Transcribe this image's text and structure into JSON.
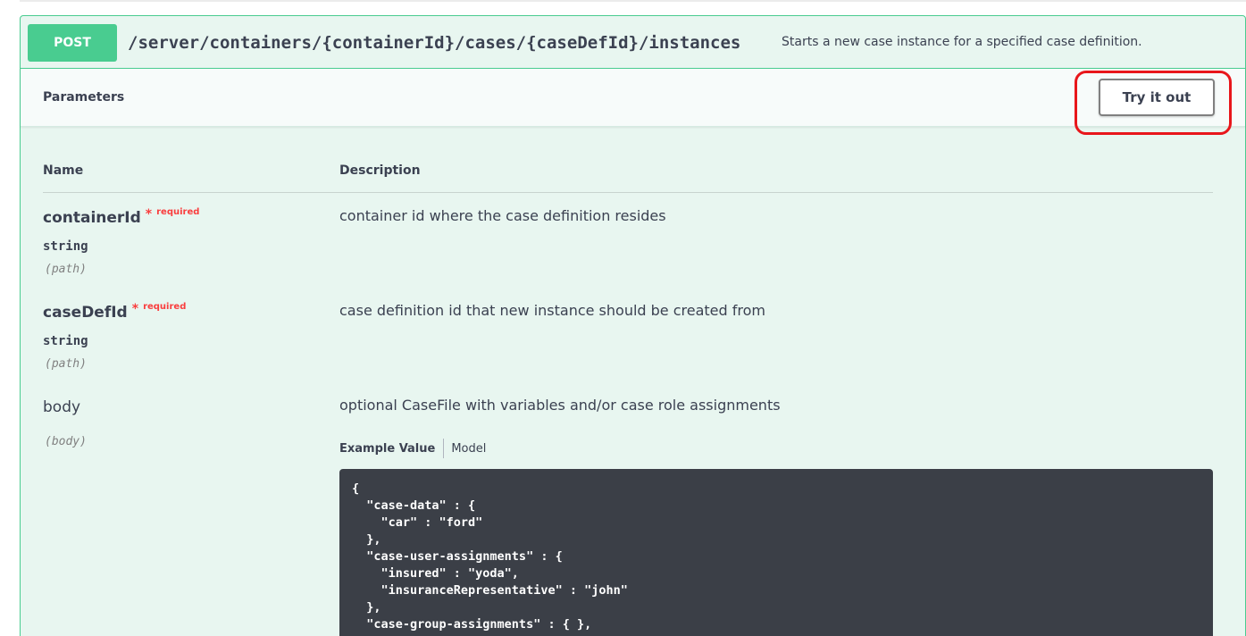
{
  "operation": {
    "method": "POST",
    "path": "/server/containers/{containerId}/cases/{caseDefId}/instances",
    "summary": "Starts a new case instance for a specified case definition."
  },
  "parameters_section": {
    "title": "Parameters",
    "try_button": "Try it out"
  },
  "columns": {
    "name": "Name",
    "description": "Description"
  },
  "parameters": [
    {
      "name": "containerId",
      "star": "*",
      "required_label": "required",
      "type": "string",
      "in": "(path)",
      "description": "container id where the case definition resides"
    },
    {
      "name": "caseDefId",
      "star": "*",
      "required_label": "required",
      "type": "string",
      "in": "(path)",
      "description": "case definition id that new instance should be created from"
    },
    {
      "name": "body",
      "in": "(body)",
      "description": "optional CaseFile with variables and/or case role assignments"
    }
  ],
  "body_tabs": {
    "example_value": "Example Value",
    "model": "Model"
  },
  "example_code": "{\n  \"case-data\" : {\n    \"car\" : \"ford\"\n  },\n  \"case-user-assignments\" : {\n    \"insured\" : \"yoda\",\n    \"insuranceRepresentative\" : \"john\"\n  },\n  \"case-group-assignments\" : { },",
  "colors": {
    "post_green": "#49cc90",
    "block_background": "#e8f6f0",
    "highlight_red": "#e8161b",
    "required_red": "#f93e3e",
    "code_background": "#3b3f47"
  }
}
